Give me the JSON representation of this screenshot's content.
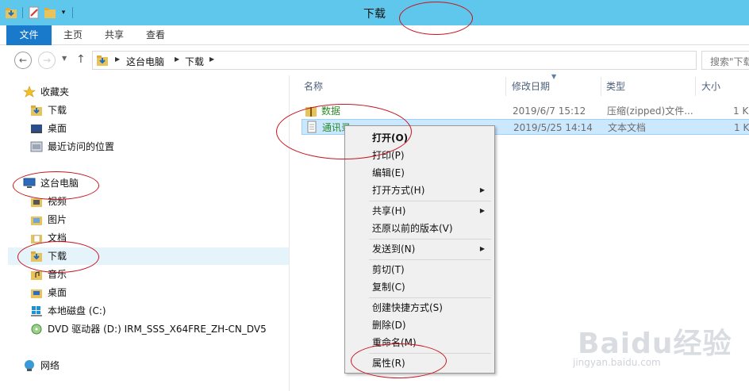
{
  "window": {
    "title": "下载"
  },
  "ribbon": {
    "tabs": [
      "文件",
      "主页",
      "共享",
      "查看"
    ]
  },
  "addressbar": {
    "crumbs": [
      "这台电脑",
      "下载"
    ],
    "search_placeholder": "搜索\"下载\""
  },
  "navpane": {
    "favorites_label": "收藏夹",
    "favorites": [
      "下载",
      "桌面",
      "最近访问的位置"
    ],
    "thispc_label": "这台电脑",
    "thispc": [
      "视频",
      "图片",
      "文档",
      "下载",
      "音乐",
      "桌面",
      "本地磁盘 (C:)",
      "DVD 驱动器 (D:) IRM_SSS_X64FRE_ZH-CN_DV5"
    ],
    "network_label": "网络"
  },
  "filelist": {
    "columns": [
      "名称",
      "修改日期",
      "类型",
      "大小"
    ],
    "rows": [
      {
        "name": "数据",
        "date": "2019/6/7 15:12",
        "type": "压缩(zipped)文件...",
        "size": "1 K"
      },
      {
        "name": "通讯录",
        "date": "2019/5/25 14:14",
        "type": "文本文档",
        "size": "1 K"
      }
    ]
  },
  "context_menu": {
    "items": [
      {
        "label": "打开(O)"
      },
      {
        "label": "打印(P)"
      },
      {
        "label": "编辑(E)"
      },
      {
        "label": "打开方式(H)"
      },
      {
        "label": "共享(H)"
      },
      {
        "label": "还原以前的版本(V)"
      },
      {
        "label": "发送到(N)"
      },
      {
        "label": "剪切(T)"
      },
      {
        "label": "复制(C)"
      },
      {
        "label": "创建快捷方式(S)"
      },
      {
        "label": "删除(D)"
      },
      {
        "label": "重命名(M)"
      },
      {
        "label": "属性(R)"
      }
    ]
  },
  "watermark": {
    "brand": "Baidu经验",
    "url": "jingyan.baidu.com"
  },
  "colors": {
    "titlebar": "#5fc6ec",
    "file_tab": "#1979ca",
    "selection": "#cce8ff",
    "annotation": "#c8141e",
    "filename_green": "#2a8a2a"
  }
}
